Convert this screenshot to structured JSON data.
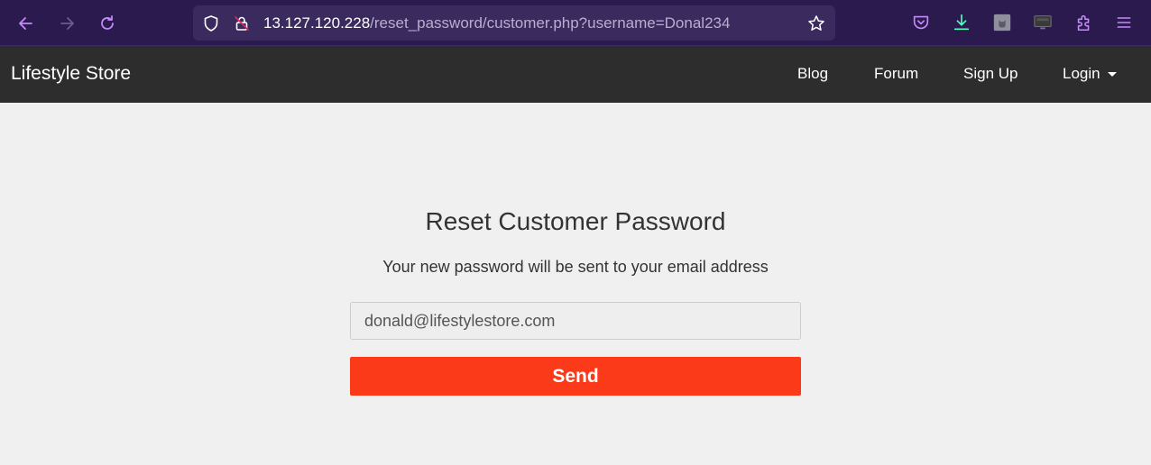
{
  "browser": {
    "url_host": "13.127.120.228",
    "url_path": "/reset_password/customer.php?username=Donal234",
    "accent_color": "#c58af9",
    "bar_color": "#2b1a4d",
    "icons": {
      "back": "back-arrow-icon",
      "forward": "forward-arrow-icon",
      "reload": "reload-icon",
      "shield": "shield-icon",
      "insecure_lock": "insecure-lock-icon",
      "bookmark": "star-icon",
      "pocket": "pocket-icon",
      "download": "download-icon",
      "extension_1": "extension-cat-icon",
      "extension_2": "extension-monitor-icon",
      "extensions": "puzzle-icon",
      "menu": "hamburger-menu-icon"
    }
  },
  "site": {
    "brand": "Lifestyle Store",
    "nav": {
      "blog": "Blog",
      "forum": "Forum",
      "signup": "Sign Up",
      "login": "Login"
    },
    "nav_bg": "#2d2d2d"
  },
  "main": {
    "heading": "Reset Customer Password",
    "subtext": "Your new password will be sent to your email address",
    "email_value": "donald@lifestylestore.com",
    "send_label": "Send",
    "send_color": "#fb3a1a"
  }
}
